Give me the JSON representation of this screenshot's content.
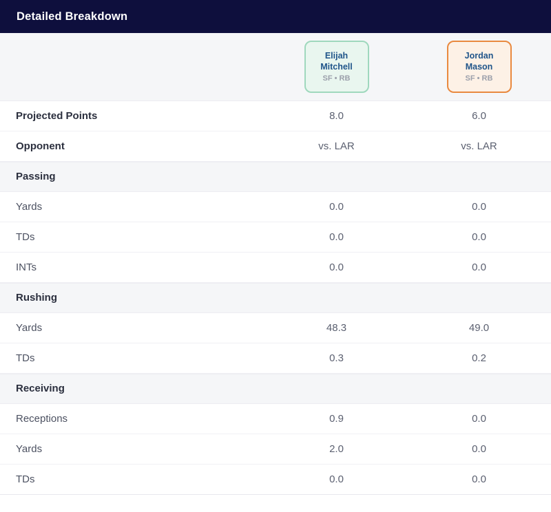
{
  "header": {
    "title": "Detailed Breakdown"
  },
  "colors": {
    "header_bg": "#0e0f3d",
    "header_text": "#ffffff",
    "section_bg": "#f5f6f8",
    "row_bg": "#ffffff",
    "player_one_accent": "#9fd8bd",
    "player_one_fill": "#e9f6ef",
    "player_two_accent": "#e9893f",
    "player_two_fill": "#fdf1e6",
    "player_name": "#20558a",
    "player_meta": "#9ca0ab",
    "label_text": "#4c5161",
    "value_text": "#5b6070"
  },
  "players": [
    {
      "first_name": "Elijah",
      "last_name": "Mitchell",
      "name": "Elijah Mitchell",
      "meta": "SF • RB",
      "team": "SF",
      "position": "RB",
      "accent": "green"
    },
    {
      "first_name": "Jordan",
      "last_name": "Mason",
      "name": "Jordan Mason",
      "meta": "SF • RB",
      "team": "SF",
      "position": "RB",
      "accent": "orange"
    }
  ],
  "rows": [
    {
      "kind": "stat",
      "label": "Projected Points",
      "emphasis": true,
      "values": [
        "8.0",
        "6.0"
      ]
    },
    {
      "kind": "stat",
      "label": "Opponent",
      "emphasis": true,
      "values": [
        "vs. LAR",
        "vs. LAR"
      ]
    },
    {
      "kind": "section",
      "label": "Passing",
      "emphasis": true,
      "values": [
        "",
        ""
      ]
    },
    {
      "kind": "stat",
      "label": "Yards",
      "emphasis": false,
      "values": [
        "0.0",
        "0.0"
      ]
    },
    {
      "kind": "stat",
      "label": "TDs",
      "emphasis": false,
      "values": [
        "0.0",
        "0.0"
      ]
    },
    {
      "kind": "stat",
      "label": "INTs",
      "emphasis": false,
      "values": [
        "0.0",
        "0.0"
      ]
    },
    {
      "kind": "section",
      "label": "Rushing",
      "emphasis": true,
      "values": [
        "",
        ""
      ]
    },
    {
      "kind": "stat",
      "label": "Yards",
      "emphasis": false,
      "values": [
        "48.3",
        "49.0"
      ]
    },
    {
      "kind": "stat",
      "label": "TDs",
      "emphasis": false,
      "values": [
        "0.3",
        "0.2"
      ]
    },
    {
      "kind": "section",
      "label": "Receiving",
      "emphasis": true,
      "values": [
        "",
        ""
      ]
    },
    {
      "kind": "stat",
      "label": "Receptions",
      "emphasis": false,
      "values": [
        "0.9",
        "0.0"
      ]
    },
    {
      "kind": "stat",
      "label": "Yards",
      "emphasis": false,
      "values": [
        "2.0",
        "0.0"
      ]
    },
    {
      "kind": "stat",
      "label": "TDs",
      "emphasis": false,
      "values": [
        "0.0",
        "0.0"
      ]
    }
  ]
}
